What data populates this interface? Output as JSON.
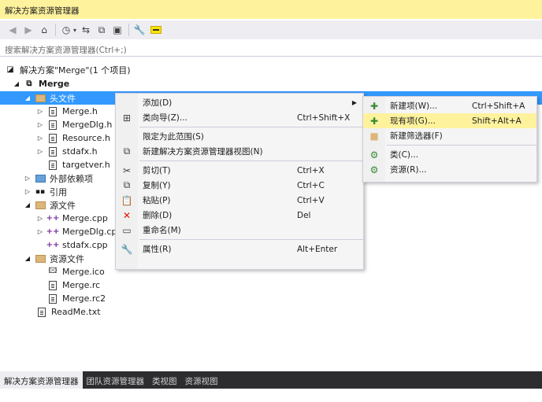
{
  "title": "解决方案资源管理器",
  "search_placeholder": "搜索解决方案资源管理器(Ctrl+;)",
  "toolbar": {
    "icons": [
      "back-icon",
      "forward-icon",
      "home-icon",
      "history-icon",
      "sync-icon",
      "collapse-icon",
      "show-all-files-icon",
      "properties-wrench-icon",
      "pin-icon"
    ]
  },
  "tree": {
    "solution": "解决方案\"Merge\"(1 个项目)",
    "project": "Merge",
    "headers_folder": "头文件",
    "headers": [
      "Merge.h",
      "MergeDlg.h",
      "Resource.h",
      "stdafx.h",
      "targetver.h"
    ],
    "external_deps": "外部依赖项",
    "references": "引用",
    "source_folder": "源文件",
    "sources": [
      "Merge.cpp",
      "MergeDlg.cpp",
      "stdafx.cpp"
    ],
    "resource_folder": "资源文件",
    "resources": [
      "Merge.ico",
      "Merge.rc",
      "Merge.rc2"
    ],
    "readme": "ReadMe.txt"
  },
  "context_menu": {
    "add": "添加(D)",
    "class_wizard": "类向导(Z)...",
    "class_wizard_key": "Ctrl+Shift+X",
    "scope_to_this": "限定为此范围(S)",
    "new_view": "新建解决方案资源管理器视图(N)",
    "cut": "剪切(T)",
    "cut_key": "Ctrl+X",
    "copy": "复制(Y)",
    "copy_key": "Ctrl+C",
    "paste": "粘贴(P)",
    "paste_key": "Ctrl+V",
    "delete": "删除(D)",
    "delete_key": "Del",
    "rename": "重命名(M)",
    "properties": "属性(R)",
    "properties_key": "Alt+Enter"
  },
  "submenu": {
    "new_item": "新建项(W)...",
    "new_item_key": "Ctrl+Shift+A",
    "existing_item": "现有项(G)...",
    "existing_item_key": "Shift+Alt+A",
    "new_filter": "新建筛选器(F)",
    "class": "类(C)...",
    "resource": "资源(R)..."
  },
  "bottom_tabs": [
    "解决方案资源管理器",
    "团队资源管理器",
    "类视图",
    "资源视图"
  ],
  "colors": {
    "title_bg": "#fff29d",
    "selection": "#3399ff",
    "menu_highlight": "#fff29d",
    "bottom_bar": "#2d2d30"
  }
}
